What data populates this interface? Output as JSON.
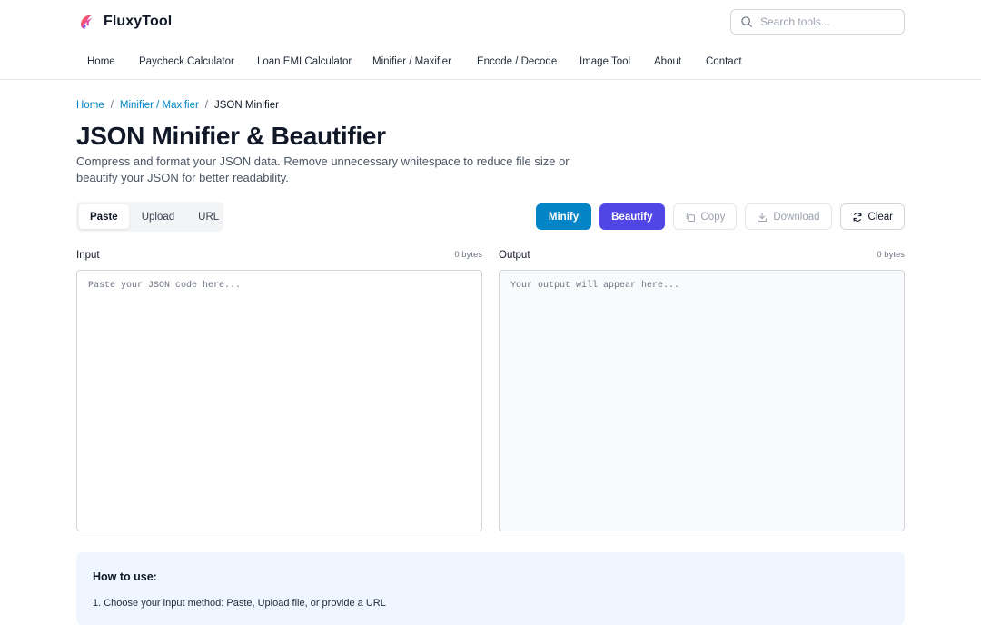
{
  "header": {
    "brand_name": "FluxyTool",
    "search_placeholder": "Search tools...",
    "nav": [
      {
        "label": "Home"
      },
      {
        "label": "Paycheck Calculator"
      },
      {
        "label": "Loan EMI Calculator"
      },
      {
        "label": "Minifier / Maxifier"
      },
      {
        "label": "Encode / Decode"
      },
      {
        "label": "Image Tool"
      },
      {
        "label": "About"
      },
      {
        "label": "Contact"
      }
    ]
  },
  "breadcrumb": {
    "home": "Home",
    "section": "Minifier / Maxifier",
    "current": "JSON Minifier",
    "separator": "/"
  },
  "page": {
    "title": "JSON Minifier & Beautifier",
    "description": "Compress and format your JSON data. Remove unnecessary whitespace to reduce file size or beautify your JSON for better readability."
  },
  "toolbar": {
    "tabs": [
      {
        "label": "Paste",
        "active": true
      },
      {
        "label": "Upload",
        "active": false
      },
      {
        "label": "URL",
        "active": false
      }
    ],
    "minify_label": "Minify",
    "beautify_label": "Beautify",
    "copy_label": "Copy",
    "download_label": "Download",
    "clear_label": "Clear"
  },
  "input": {
    "label": "Input",
    "size": "0 bytes",
    "value": "",
    "placeholder": "Paste your JSON code here..."
  },
  "output": {
    "label": "Output",
    "size": "0 bytes",
    "value": "",
    "placeholder": "Your output will appear here..."
  },
  "howto": {
    "title": "How to use:",
    "steps": [
      "1. Choose your input method: Paste, Upload file, or provide a URL"
    ]
  },
  "colors": {
    "accent": "#0284c7",
    "beautify": "#4f46e5",
    "howto_bg": "#eff6ff"
  },
  "icons": {
    "brand": "flame-logo-icon",
    "search": "search-icon",
    "copy": "copy-icon",
    "download": "download-icon",
    "clear": "refresh-icon"
  }
}
